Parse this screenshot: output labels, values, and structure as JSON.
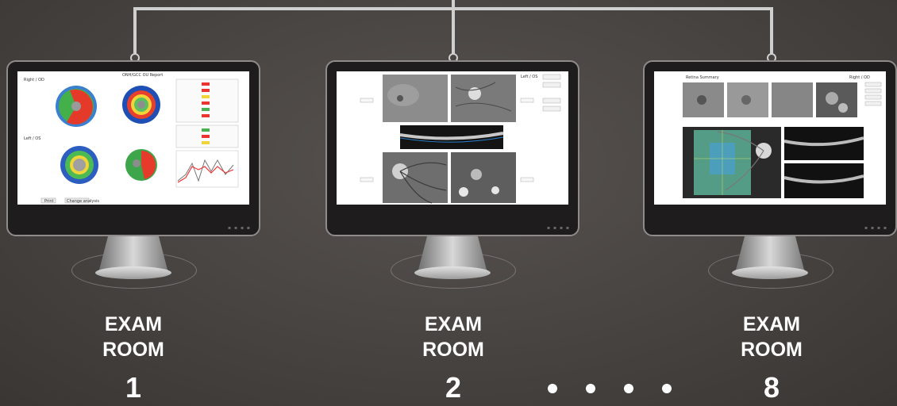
{
  "rooms": [
    {
      "word1": "EXAM",
      "word2": "ROOM",
      "number": "1"
    },
    {
      "word1": "EXAM",
      "word2": "ROOM",
      "number": "2"
    },
    {
      "word1": "EXAM",
      "word2": "ROOM",
      "number": "8"
    }
  ],
  "screens": {
    "room1": {
      "title": "ONH/GCC OU Report",
      "right_label": "Right / OD",
      "left_label": "Left / OS",
      "btn1": "Print",
      "btn2": "Change analysis"
    },
    "room2": {
      "eye_label": "Left / OS"
    },
    "room8": {
      "title": "Retina Summary",
      "eye_label": "Right / OD"
    }
  },
  "colors": {
    "background": "#4a4644",
    "wire": "#cfcfcf",
    "label": "#ffffff"
  },
  "continuation_dots": 4
}
